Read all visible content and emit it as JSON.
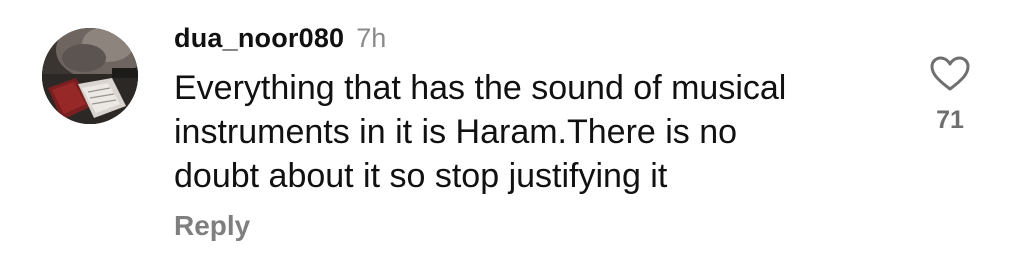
{
  "comment": {
    "username": "dua_noor080",
    "timestamp": "7h",
    "text_lines": [
      "Everything that has the sound of musical",
      "instruments in it is Haram.There is no",
      "doubt about it so stop justifying it"
    ],
    "reply_label": "Reply",
    "like_count": "71",
    "like_icon": "heart-outline-icon"
  }
}
